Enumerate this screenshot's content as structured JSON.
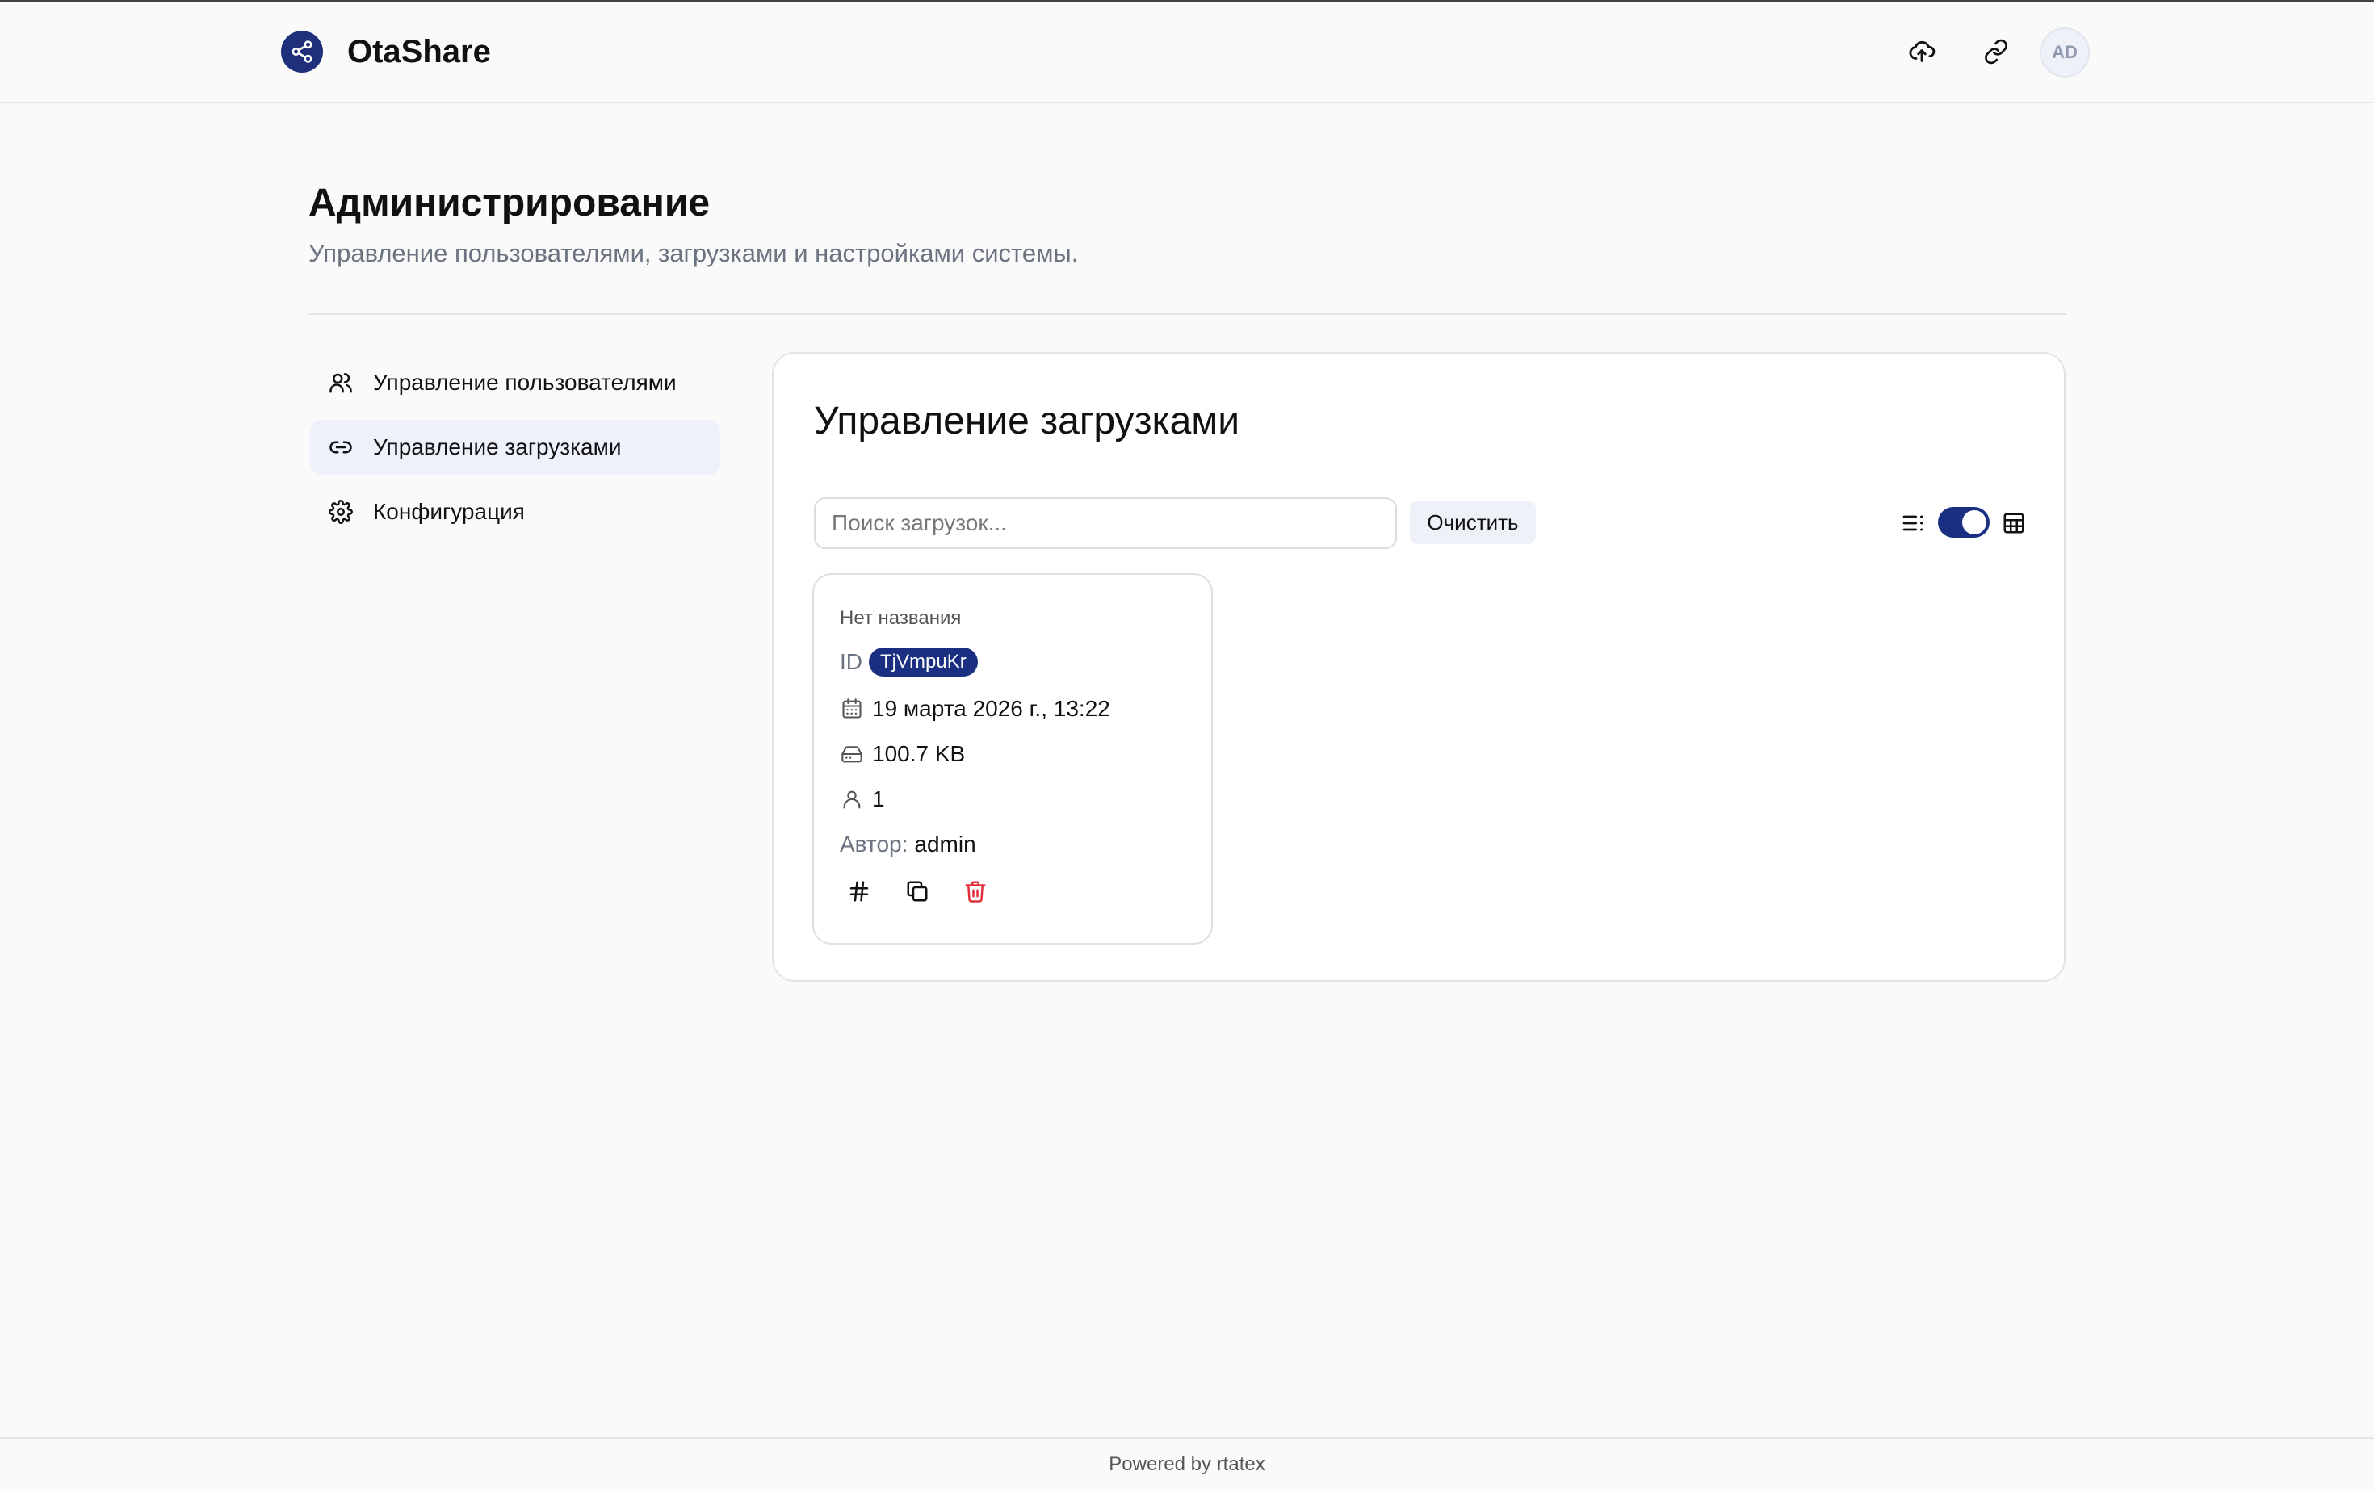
{
  "app": {
    "name": "OtaShare",
    "avatar_initials": "AD"
  },
  "header": {
    "icons": [
      "share-icon",
      "upload-cloud-icon",
      "link-icon"
    ]
  },
  "page": {
    "title": "Администрирование",
    "subtitle": "Управление пользователями, загрузками и настройками системы."
  },
  "sidebar": {
    "items": [
      {
        "label": "Управление пользователями",
        "icon": "users-icon",
        "active": false
      },
      {
        "label": "Управление загрузками",
        "icon": "link-icon",
        "active": true
      },
      {
        "label": "Конфигурация",
        "icon": "gear-icon",
        "active": false
      }
    ]
  },
  "main": {
    "title": "Управление загрузками",
    "search": {
      "placeholder": "Поиск загрузок...",
      "value": ""
    },
    "clear_label": "Очистить",
    "view_toggle": {
      "list_icon": "list-icon",
      "grid_icon": "grid-icon",
      "grid_enabled": true
    }
  },
  "uploads": [
    {
      "title": "Нет названия",
      "id_label": "ID",
      "id": "TjVmpuKr",
      "date": "19 марта 2026 г., 13:22",
      "size": "100.7 KB",
      "recipients": "1",
      "author_label": "Автор:",
      "author": "admin"
    }
  ],
  "colors": {
    "accent": "#1a2f82",
    "danger": "#e0313b",
    "muted": "#6b7280"
  },
  "footer": {
    "text": "Powered by rtatex"
  }
}
